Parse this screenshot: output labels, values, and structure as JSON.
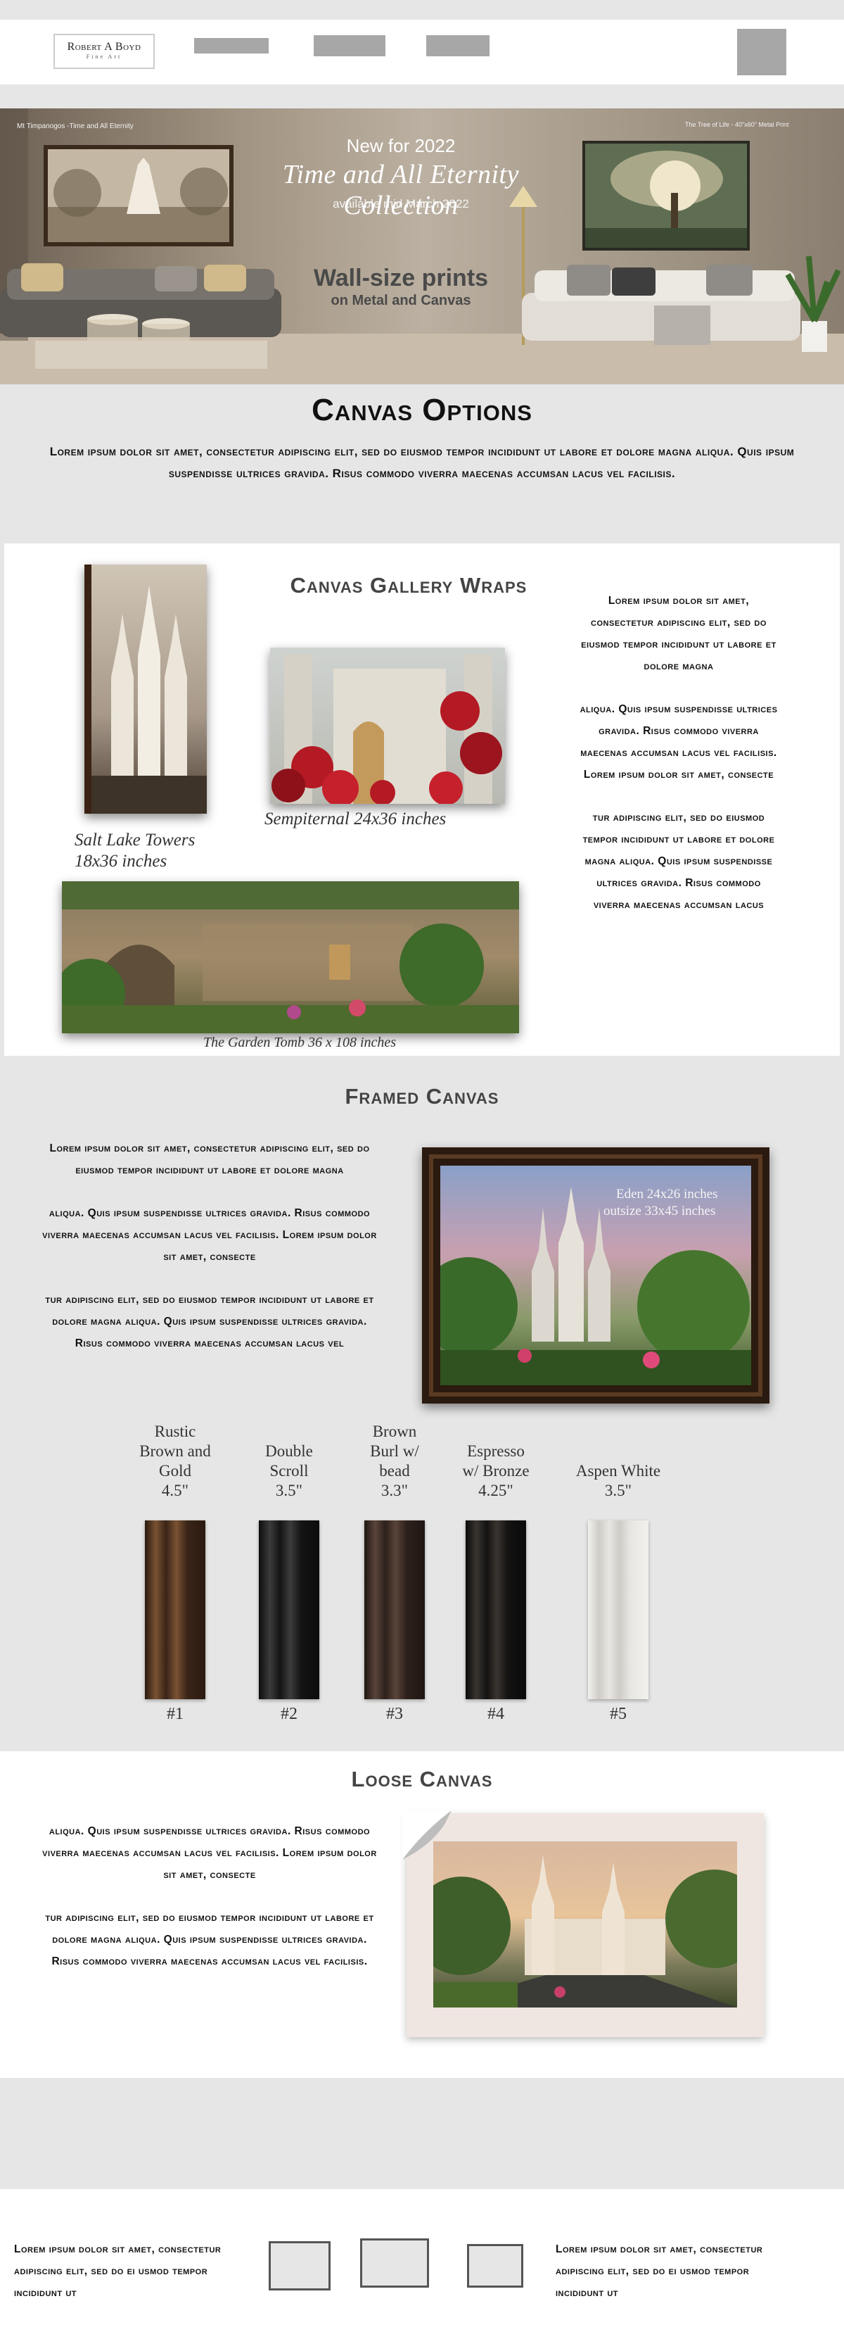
{
  "header": {
    "logo_line1": "Robert A Boyd",
    "logo_line2": "Fine Art"
  },
  "hero": {
    "left_caption": "Mt Timpanogos -Time and All Eternity",
    "right_caption": "The Tree of Life - 40\"x60\" Metal Print",
    "new_label": "New for 2022",
    "collection_title": "Time and All Eternity Collection",
    "availability": "available mid March 2022",
    "wall_size": "Wall-size prints",
    "materials": "on Metal and Canvas"
  },
  "canvas_options": {
    "title": "Canvas Options",
    "intro": "Lorem ipsum dolor sit amet, consectetur adipiscing elit, sed do eiusmod tempor incididunt ut labore et dolore magna aliqua. Quis ipsum suspendisse ultrices gravida. Risus commodo viverra maecenas accumsan lacus vel facilisis."
  },
  "gallery_wraps": {
    "title": "Canvas Gallery Wraps",
    "caption1_line1": "Salt Lake Towers",
    "caption1_line2": "18x36 inches",
    "caption2": "Sempiternal 24x36 inches",
    "caption3": "The Garden Tomb 36 x 108 inches",
    "para1": "Lorem ipsum dolor sit amet, consectetur adipiscing elit, sed do eiusmod tempor incididunt ut labore et dolore magna",
    "para2": "aliqua. Quis ipsum suspendisse ultrices gravida. Risus commodo viverra maecenas accumsan lacus vel facilisis. Lorem ipsum dolor sit amet, consecte",
    "para3": "tur adipiscing elit, sed do eiusmod tempor incididunt ut labore et dolore magna aliqua. Quis ipsum suspendisse ultrices gravida. Risus commodo viverra maecenas accumsan lacus"
  },
  "framed": {
    "title": "Framed Canvas",
    "para1": "Lorem ipsum dolor sit amet, consectetur adipiscing elit, sed do eiusmod tempor incididunt ut labore et dolore magna",
    "para2": "aliqua. Quis ipsum suspendisse ultrices gravida. Risus commodo viverra maecenas accumsan lacus vel facilisis. Lorem ipsum dolor sit amet, consecte",
    "para3": "tur adipiscing elit, sed do eiusmod tempor incididunt ut labore et dolore magna aliqua. Quis ipsum suspendisse ultrices gravida. Risus commodo viverra maecenas accumsan lacus vel",
    "image_caption_line1": "Eden 24x26 inches",
    "image_caption_line2": "outsize 33x45 inches",
    "frames": [
      {
        "name_lines": [
          "Rustic",
          "Brown and",
          "Gold"
        ],
        "size": "4.5\"",
        "num": "#1",
        "colors": [
          "#3a2418",
          "#7a5232",
          "#2a1a10"
        ]
      },
      {
        "name_lines": [
          "Double",
          "Scroll"
        ],
        "size": "3.5\"",
        "num": "#2",
        "colors": [
          "#141414",
          "#3c3c3c",
          "#0c0c0c"
        ]
      },
      {
        "name_lines": [
          "Brown",
          "Burl w/",
          "bead"
        ],
        "size": "3.3\"",
        "num": "#3",
        "colors": [
          "#2d211b",
          "#5a443a",
          "#1f1612"
        ]
      },
      {
        "name_lines": [
          "Espresso",
          "w/ Bronze"
        ],
        "size": "4.25\"",
        "num": "#4",
        "colors": [
          "#141212",
          "#3a3530",
          "#0a0a0a"
        ]
      },
      {
        "name_lines": [
          "Aspen White"
        ],
        "size": "3.5\"",
        "num": "#5",
        "colors": [
          "#e8e6e2",
          "#cfccc6",
          "#f2f1ee"
        ]
      }
    ]
  },
  "loose": {
    "title": "Loose Canvas",
    "para1": "aliqua. Quis ipsum suspendisse ultrices gravida. Risus commodo viverra maecenas accumsan lacus vel facilisis. Lorem ipsum dolor sit amet, consecte",
    "para2": "tur adipiscing elit, sed do eiusmod tempor incididunt ut labore et dolore magna aliqua. Quis ipsum suspendisse ultrices gravida. Risus commodo viverra maecenas accumsan lacus vel facilisis."
  },
  "footer": {
    "left_text": "Lorem ipsum dolor sit amet, consectetur adipiscing elit, sed do ei usmod tempor incididunt ut",
    "right_text": "Lorem ipsum dolor sit amet, consectetur adipiscing elit, sed do ei usmod tempor incididunt ut"
  }
}
